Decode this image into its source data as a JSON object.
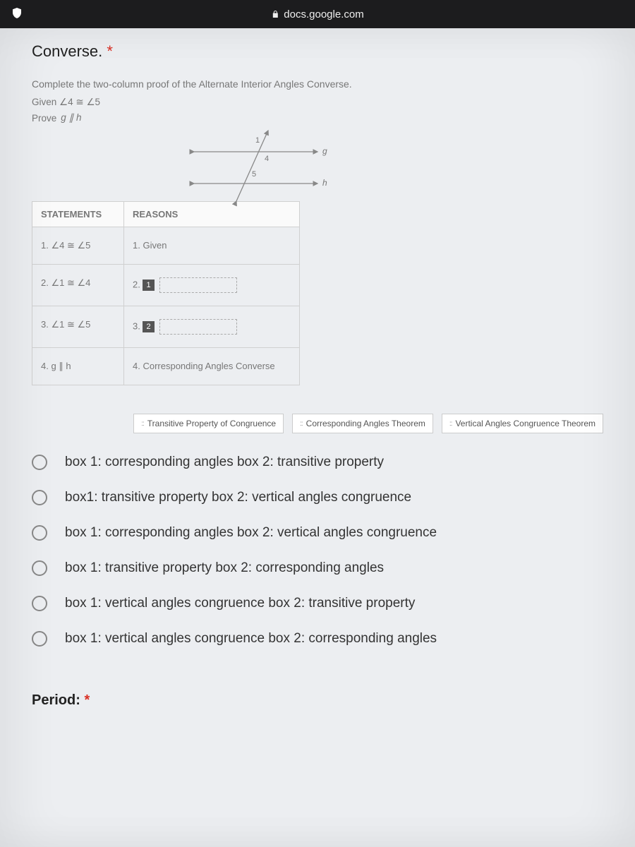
{
  "statusbar": {
    "url": "docs.google.com"
  },
  "question": {
    "title": "Converse.",
    "required_mark": "*",
    "instruction": "Complete the two-column proof of the Alternate Interior Angles Converse.",
    "given": "Given  ∠4 ≅ ∠5",
    "prove_label": "Prove",
    "prove_expr": "g ∥ h"
  },
  "figure": {
    "labels": {
      "g": "g",
      "h": "h",
      "a1": "1",
      "a4": "4",
      "a5": "5"
    }
  },
  "proof": {
    "headers": {
      "statements": "STATEMENTS",
      "reasons": "REASONS"
    },
    "rows": [
      {
        "stmt": "1. ∠4 ≅ ∠5",
        "reason_prefix": "1.",
        "reason": "Given",
        "box": null
      },
      {
        "stmt": "2. ∠1 ≅ ∠4",
        "reason_prefix": "2.",
        "reason": "",
        "box": "1"
      },
      {
        "stmt": "3. ∠1 ≅ ∠5",
        "reason_prefix": "3.",
        "reason": "",
        "box": "2"
      },
      {
        "stmt": "4. g ∥ h",
        "reason_prefix": "4.",
        "reason": "Corresponding Angles Converse",
        "box": null
      }
    ]
  },
  "chips": [
    "Transitive Property of Congruence",
    "Corresponding Angles Theorem",
    "Vertical Angles Congruence Theorem"
  ],
  "options": [
    "box 1: corresponding angles box 2: transitive property",
    "box1: transitive property box 2: vertical angles congruence",
    "box 1: corresponding angles box 2: vertical angles congruence",
    "box 1: transitive property box 2: corresponding angles",
    "box 1: vertical angles congruence box 2: transitive property",
    "box 1: vertical angles congruence box 2: corresponding angles"
  ],
  "next_question": {
    "title_partial": "Period:",
    "required_mark": "*"
  }
}
